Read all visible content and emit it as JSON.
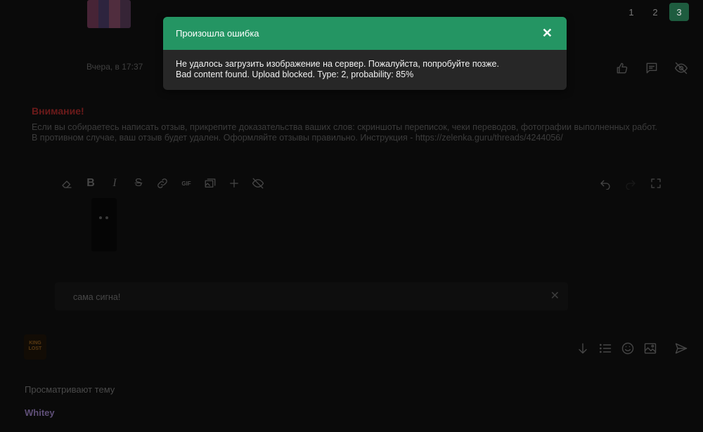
{
  "pagination": {
    "pages": [
      "1",
      "2",
      "3"
    ],
    "current": "3"
  },
  "post": {
    "time": "Вчера, в 17:37"
  },
  "warning": {
    "title": "Внимание!",
    "line1": "Если вы собираетесь написать отзыв, прикрепите доказательства ваших слов: скриншоты переписок, чеки переводов, фотографии выполненных работ.",
    "line2": "В противном случае, ваш отзыв будет удален. Оформляйте отзывы правильно. Инструкция - https://zelenka.guru/threads/4244056/"
  },
  "editor": {
    "toolbar_gif": "GIF"
  },
  "quote": {
    "text": "сама сигна!"
  },
  "avatar": {
    "text": "KING LOST"
  },
  "viewing": {
    "label": "Просматривают тему",
    "users": [
      "Whitey"
    ]
  },
  "toast": {
    "title": "Произошла ошибка",
    "close_glyph": "✕",
    "message_line1": "Не удалось загрузить изображение на сервер. Пожалуйста, попробуйте позже.",
    "message_line2": "Bad content found. Upload blocked. Type: 2, probability: 85%"
  },
  "colors": {
    "accent": "#249563",
    "page_active": "#1e5c3f",
    "warning": "#6b1a1a"
  }
}
